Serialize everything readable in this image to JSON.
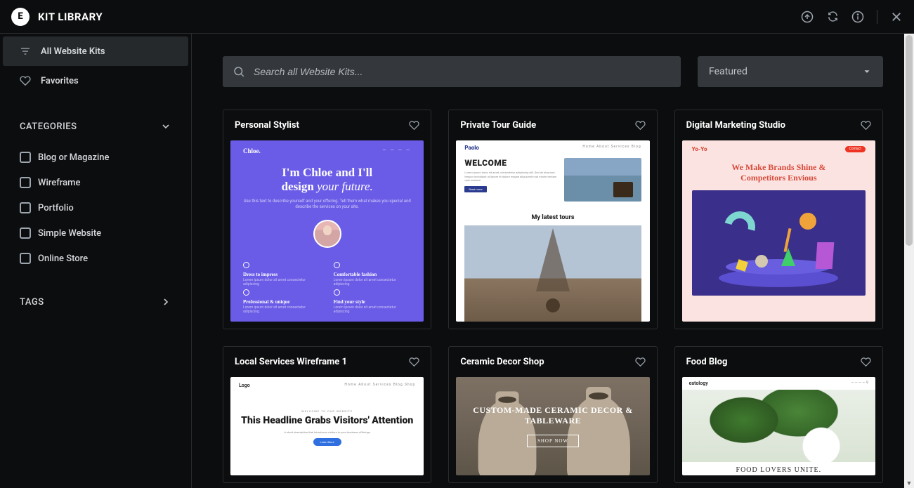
{
  "header": {
    "title": "KIT LIBRARY"
  },
  "sidebar": {
    "all_kits": "All Website Kits",
    "favorites": "Favorites",
    "categories_label": "CATEGORIES",
    "tags_label": "TAGS",
    "categories": [
      "Blog or Magazine",
      "Wireframe",
      "Portfolio",
      "Simple Website",
      "Online Store"
    ]
  },
  "toolbar": {
    "search_placeholder": "Search all Website Kits...",
    "sort_selected": "Featured"
  },
  "cards": [
    {
      "title": "Personal Stylist"
    },
    {
      "title": "Private Tour Guide"
    },
    {
      "title": "Digital Marketing Studio"
    },
    {
      "title": "Local Services Wireframe 1"
    },
    {
      "title": "Ceramic Decor Shop"
    },
    {
      "title": "Food Blog"
    }
  ],
  "thumbs": {
    "chloe": {
      "brand": "Chloe.",
      "headline_1": "I'm Chloe and I'll",
      "headline_2a": "design ",
      "headline_2b": "your future.",
      "sub": "Use this text to describe yourself and your offering. Tell them what makes you special and describe the services on your site.",
      "f1": "Dress to impress",
      "f2": "Comfortable fashion",
      "f3": "Professional & unique",
      "f4": "Find your style",
      "fd": "Lorem ipsum dolor sit amet consectetur adipiscing"
    },
    "paolo": {
      "brand": "Paolo",
      "menu": "Home   About   Services   Blog",
      "welcome": "WELCOME",
      "para": "Lorem ipsum dolor sit amet, consectetur adipiscing elit. Sed do eiusmod tempor incididunt ut labore et dolore magna aliqua enim ad minim veniam quis nostrud.",
      "btn": "Read more",
      "latest": "My latest tours"
    },
    "yoyo": {
      "brand": "Yo-Yo",
      "cta": "Contact",
      "headline": "We Make Brands Shine & Competitors Envious"
    },
    "wire": {
      "brand": "Logo",
      "menu": "Home  About  Services  Blog  Shop",
      "kicker": "WELCOME TO OUR WEBSITE",
      "headline": "This Headline Grabs Visitors' Attention",
      "sub": "A short description that introduces visitors to your business offerings",
      "btn": "Learn More"
    },
    "ceramic": {
      "headline": "CUSTOM-MADE CERAMIC DECOR & TABLEWARE",
      "btn": "SHOP NOW"
    },
    "food": {
      "brand": "eatology",
      "caption": "FOOD LOVERS UNITE."
    }
  }
}
